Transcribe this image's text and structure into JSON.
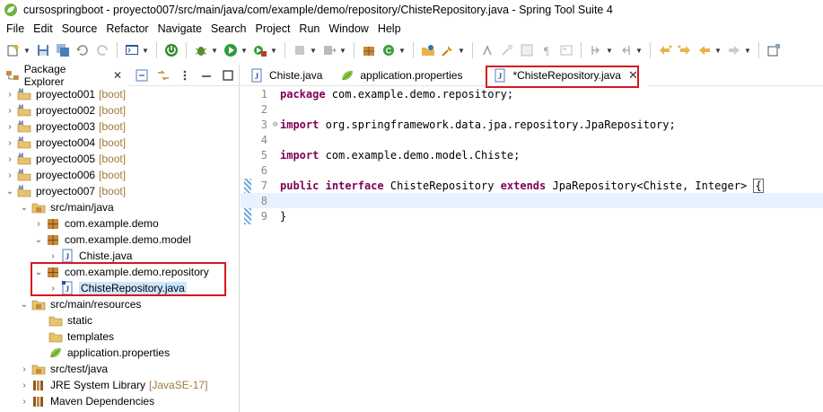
{
  "window": {
    "title": "cursospringboot - proyecto007/src/main/java/com/example/demo/repository/ChisteRepository.java - Spring Tool Suite 4"
  },
  "menu": [
    "File",
    "Edit",
    "Source",
    "Refactor",
    "Navigate",
    "Search",
    "Project",
    "Run",
    "Window",
    "Help"
  ],
  "package_explorer": {
    "tab_label": "Package Explorer",
    "close": "✕",
    "tree": [
      {
        "label": "proyecto001",
        "deco": "[boot]"
      },
      {
        "label": "proyecto002",
        "deco": "[boot]"
      },
      {
        "label": "proyecto003",
        "deco": "[boot]"
      },
      {
        "label": "proyecto004",
        "deco": "[boot]"
      },
      {
        "label": "proyecto005",
        "deco": "[boot]"
      },
      {
        "label": "proyecto006",
        "deco": "[boot]"
      },
      {
        "label": "proyecto007",
        "deco": "[boot]"
      },
      {
        "label": "src/main/java"
      },
      {
        "label": "com.example.demo"
      },
      {
        "label": "com.example.demo.model"
      },
      {
        "label": "Chiste.java"
      },
      {
        "label": "com.example.demo.repository"
      },
      {
        "label": "ChisteRepository.java"
      },
      {
        "label": "src/main/resources"
      },
      {
        "label": "static"
      },
      {
        "label": "templates"
      },
      {
        "label": "application.properties"
      },
      {
        "label": "src/test/java"
      },
      {
        "label": "JRE System Library",
        "deco": "[JavaSE-17]"
      },
      {
        "label": "Maven Dependencies"
      }
    ]
  },
  "editor": {
    "tabs": [
      {
        "label": "Chiste.java"
      },
      {
        "label": "application.properties"
      },
      {
        "label": "*ChisteRepository.java",
        "close": "✕"
      }
    ],
    "line_numbers": [
      "1",
      "2",
      "3",
      "4",
      "5",
      "6",
      "7",
      "8",
      "9"
    ],
    "code": {
      "l1_kw": "package",
      "l1_rest": " com.example.demo.repository;",
      "l3_kw": "import",
      "l3_rest": " org.springframework.data.jpa.repository.JpaRepository;",
      "l5_kw": "import",
      "l5_rest": " com.example.demo.model.Chiste;",
      "l7_kw1": "public",
      "l7_kw2": "interface",
      "l7_mid": " ChisteRepository ",
      "l7_kw3": "extends",
      "l7_rest": " JpaRepository<Chiste, Integer> ",
      "l7_brace": "{",
      "l9": "}"
    }
  },
  "colors": {
    "keyword": "#7f0055",
    "highlight_box": "#d6171f",
    "selection": "#cce8ff",
    "decoration": "#a07a3a"
  }
}
